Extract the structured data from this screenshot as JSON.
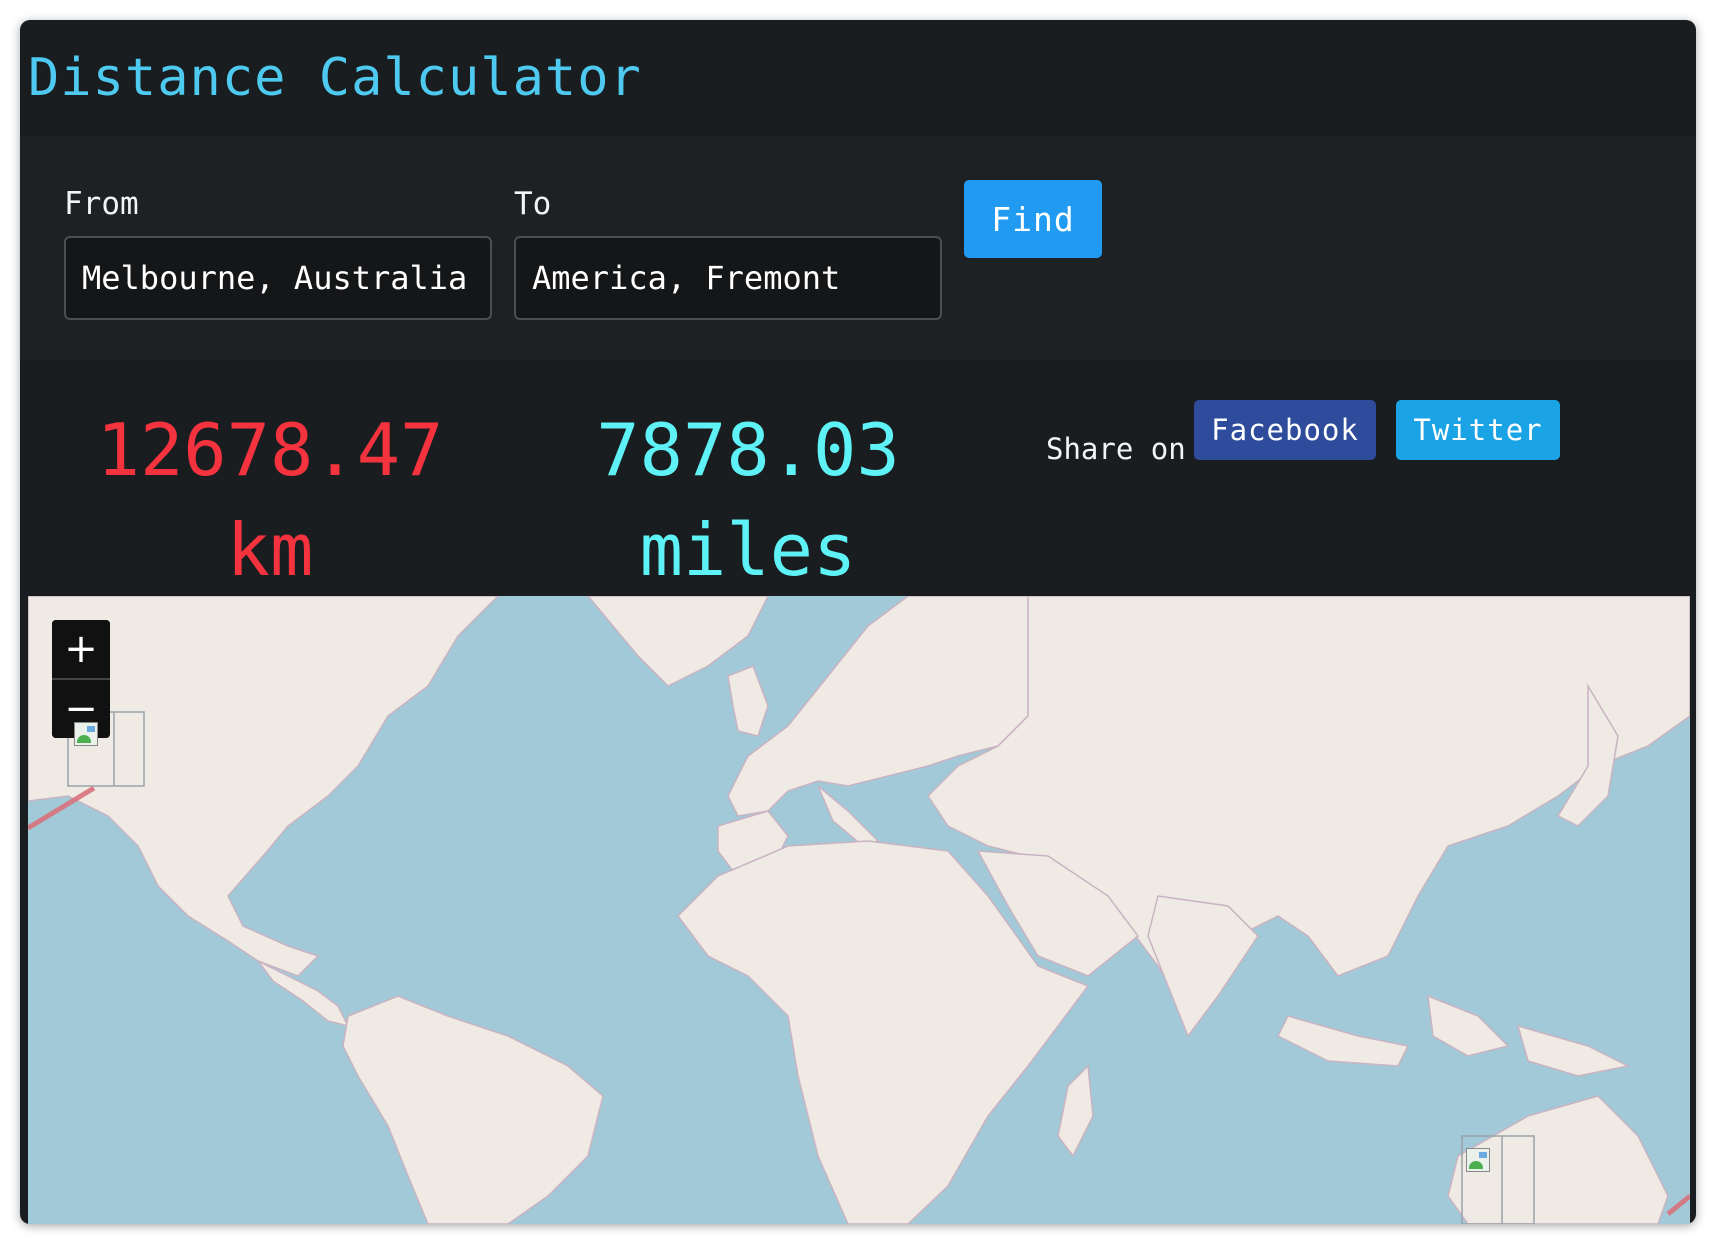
{
  "app": {
    "title": "Distance Calculator"
  },
  "form": {
    "from_label": "From",
    "from_value": "Melbourne, Australia",
    "to_label": "To",
    "to_value": "America, Fremont",
    "find_label": "Find"
  },
  "result": {
    "km_value": "12678.47",
    "km_unit": "km",
    "miles_value": "7878.03",
    "miles_unit": "miles"
  },
  "share": {
    "label": "Share on",
    "facebook": "Facebook",
    "twitter": "Twitter"
  },
  "map": {
    "zoom_in": "+",
    "zoom_out": "−",
    "ocean_color": "#a2c9d8",
    "land_color": "#efebe4",
    "route_color": "#d9737c"
  },
  "colors": {
    "title": "#4ec9f0",
    "km": "#f5333f",
    "miles": "#5ef1f5",
    "find": "#219bf2",
    "facebook": "#2e4b9c",
    "twitter": "#1aa4e5"
  }
}
